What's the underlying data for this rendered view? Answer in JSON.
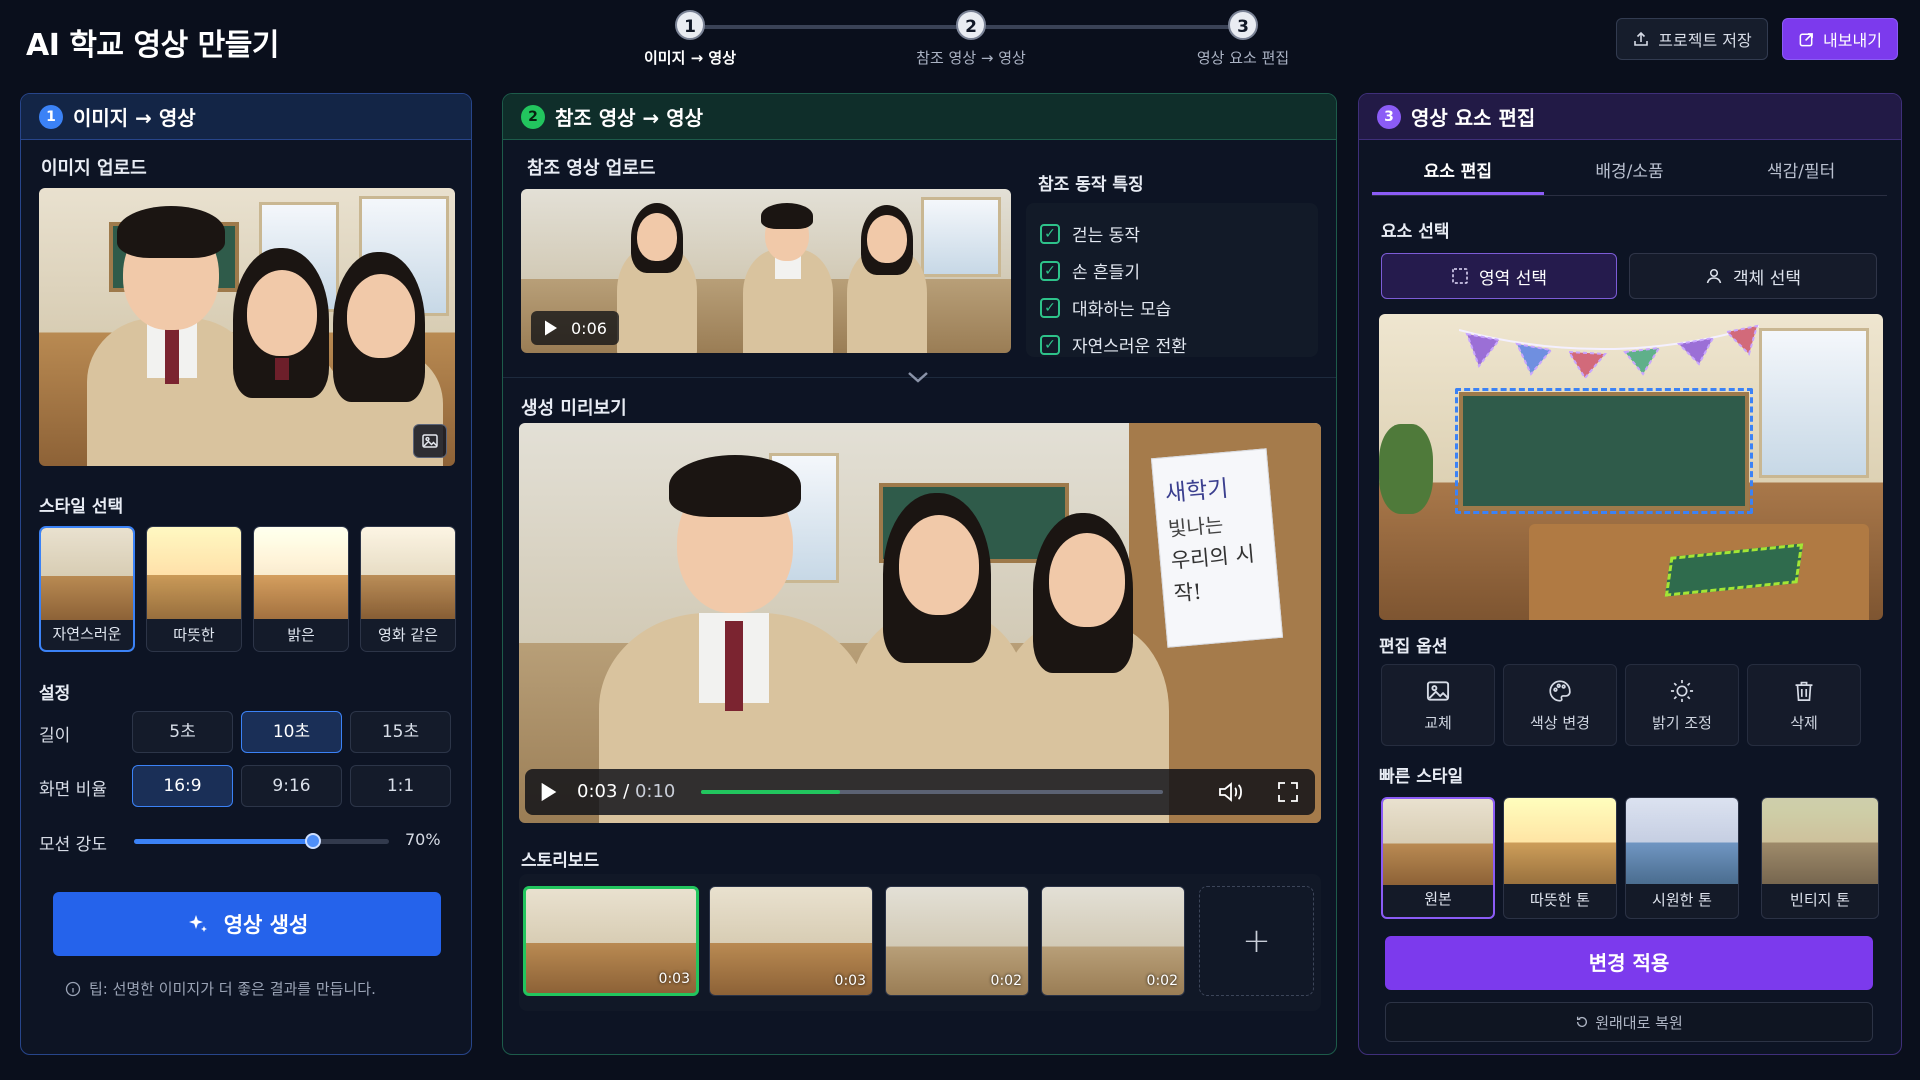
{
  "app": {
    "title": "AI 학교 영상 만들기"
  },
  "stepper": [
    {
      "num": "1",
      "label": "이미지 → 영상"
    },
    {
      "num": "2",
      "label": "참조 영상 → 영상"
    },
    {
      "num": "3",
      "label": "영상 요소 편집"
    }
  ],
  "header": {
    "save_label": "프로젝트 저장",
    "export_label": "내보내기"
  },
  "panel1": {
    "num": "1",
    "title": "이미지 → 영상",
    "upload_title": "이미지 업로드",
    "style_title": "스타일 선택",
    "styles": [
      "자연스러운",
      "따뜻한",
      "밝은",
      "영화 같은"
    ],
    "settings_title": "설정",
    "length_label": "길이",
    "lengths": [
      "5초",
      "10초",
      "15초"
    ],
    "ratio_label": "화면 비율",
    "ratios": [
      "16:9",
      "9:16",
      "1:1"
    ],
    "motion_label": "모션 강도",
    "motion_value": "70%",
    "motion_level": 0.7,
    "generate_label": "영상 생성",
    "tip": "팁: 선명한 이미지가 더 좋은 결과를 만듭니다."
  },
  "panel2": {
    "num": "2",
    "title": "참조 영상 → 영상",
    "upload_title": "참조 영상 업로드",
    "ref_time": "0:06",
    "features_title": "참조 동작 특징",
    "features": [
      "걷는 동작",
      "손 흔들기",
      "대화하는 모습",
      "자연스러운 전환"
    ],
    "preview_title": "생성 미리보기",
    "current_time": "0:03",
    "total_time": "0:10",
    "progress": 0.3,
    "poster_lines": [
      "새학기",
      "빛나는",
      "우리의 시작!"
    ],
    "storyboard_title": "스토리보드",
    "storyboard": [
      {
        "time": "0:03"
      },
      {
        "time": "0:03"
      },
      {
        "time": "0:02"
      },
      {
        "time": "0:02"
      }
    ],
    "add_label": "+"
  },
  "panel3": {
    "num": "3",
    "title": "영상 요소 편집",
    "tabs": [
      "요소 편집",
      "배경/소품",
      "색감/필터"
    ],
    "select_title": "요소 선택",
    "region_select": "영역 선택",
    "object_select": "객체 선택",
    "options_title": "편집 옵션",
    "options": [
      "교체",
      "색상 변경",
      "밝기 조정",
      "삭제"
    ],
    "quick_title": "빠른 스타일",
    "quick_styles": [
      "원본",
      "따뜻한 톤",
      "시원한 톤",
      "빈티지 톤"
    ],
    "apply_label": "변경 적용",
    "reset_label": "원래대로 복원"
  },
  "colors": {
    "blue": "#2563eb",
    "green": "#22c55e",
    "purple": "#7c3aed",
    "bg": "#0a0f1c"
  }
}
